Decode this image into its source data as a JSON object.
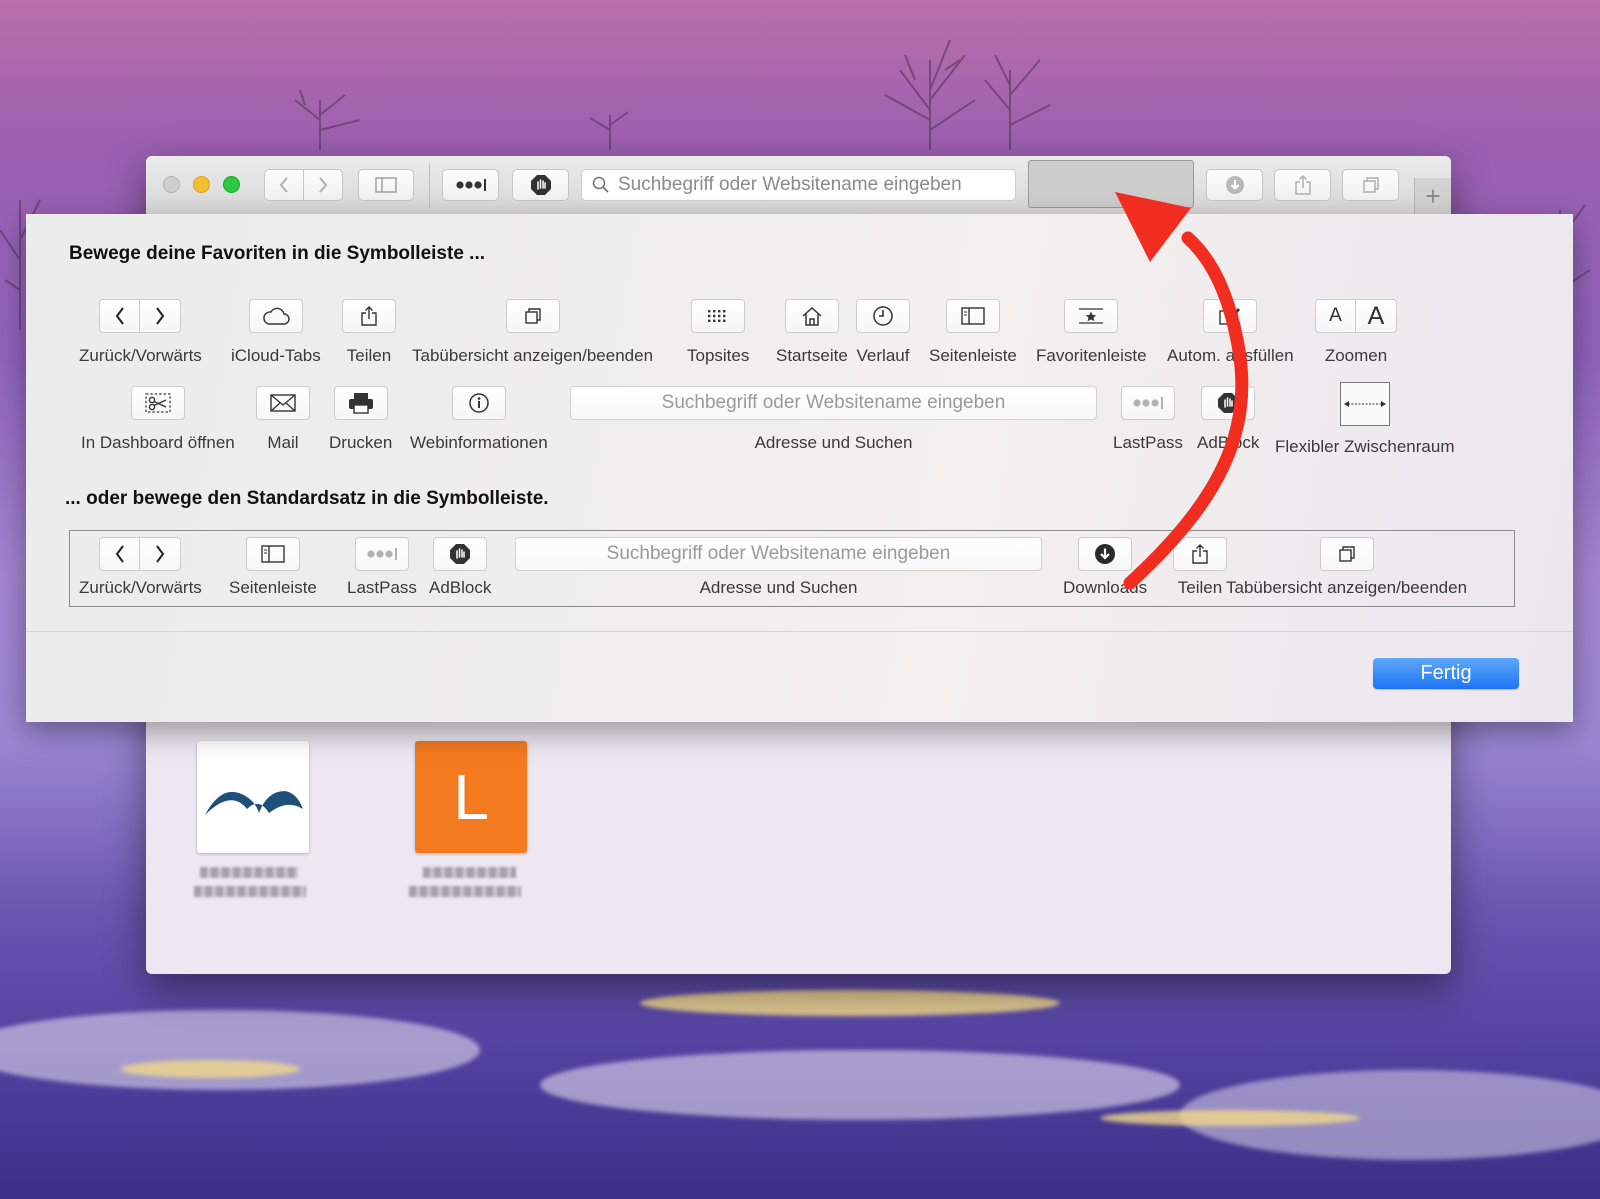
{
  "browser": {
    "address_placeholder": "Suchbegriff oder Websitename eingeben",
    "newtab_label": "+"
  },
  "topsites": {
    "tile2_letter": "L",
    "tile2_color": "#f47a20"
  },
  "customize": {
    "heading_favorites": "Bewege deine Favoriten in die Symbolleiste ...",
    "heading_default": "... oder bewege den Standardsatz in die Symbolleiste.",
    "items": {
      "back_forward": "Zurück/Vorwärts",
      "icloud_tabs": "iCloud-Tabs",
      "share": "Teilen",
      "tab_overview": "Tabübersicht anzeigen/beenden",
      "topsites": "Topsites",
      "homepage": "Startseite",
      "history": "Verlauf",
      "sidebar": "Seitenleiste",
      "favorites_bar": "Favoritenleiste",
      "autofill": "Autom. ausfüllen",
      "zoom": "Zoomen",
      "zoom_small": "A",
      "zoom_large": "A",
      "dashboard": "In Dashboard öffnen",
      "mail": "Mail",
      "print": "Drucken",
      "web_info": "Webinformationen",
      "address_search": "Adresse und Suchen",
      "address_placeholder": "Suchbegriff oder Websitename eingeben",
      "lastpass": "LastPass",
      "adblock": "AdBlock",
      "flexible_space": "Flexibler Zwischenraum"
    },
    "default_set": {
      "back_forward": "Zurück/Vorwärts",
      "sidebar": "Seitenleiste",
      "lastpass": "LastPass",
      "adblock": "AdBlock",
      "address_search": "Adresse und Suchen",
      "address_placeholder": "Suchbegriff oder Websitename eingeben",
      "downloads": "Downloads",
      "share": "Teilen",
      "tab_overview": "Tabübersicht anzeigen/beenden"
    },
    "done_label": "Fertig"
  },
  "colors": {
    "accent_blue": "#1c74f5",
    "arrow_red": "#f02d1f"
  }
}
